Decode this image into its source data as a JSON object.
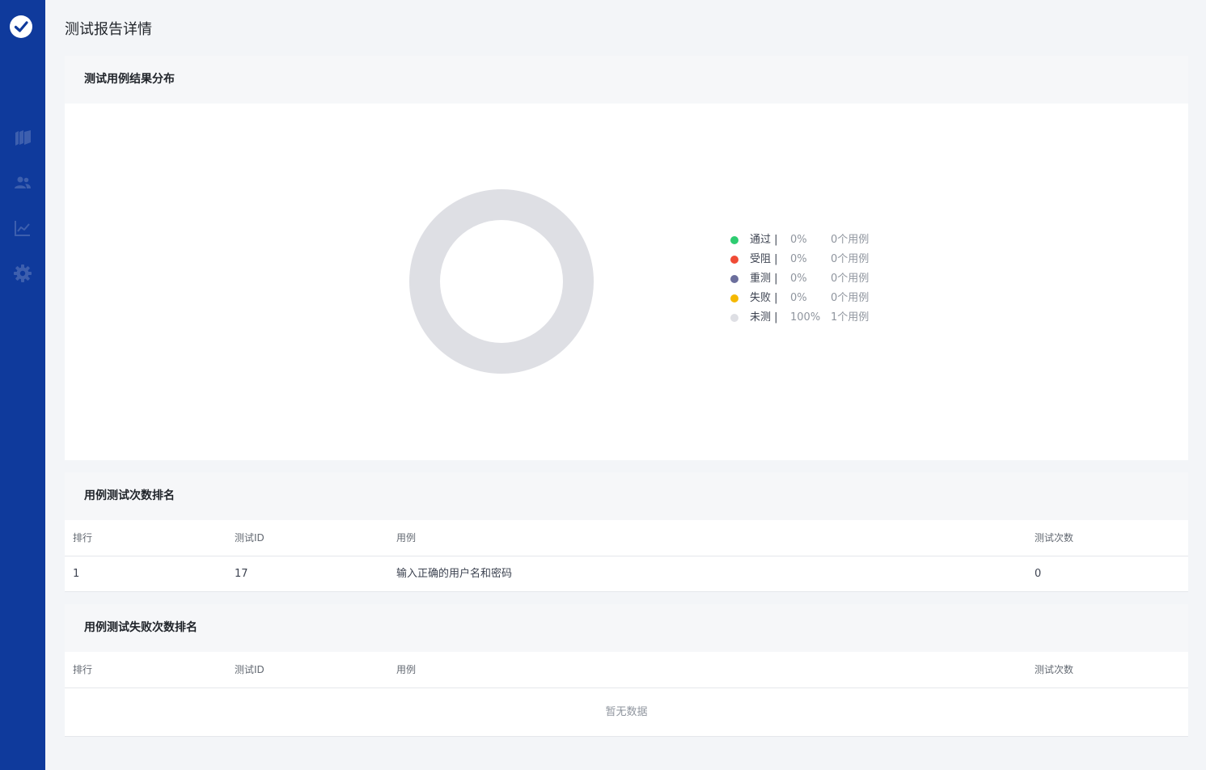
{
  "page": {
    "title": "测试报告详情"
  },
  "sidebar": {
    "logo_icon": "check-circle-logo",
    "items": [
      {
        "icon": "layers-icon"
      },
      {
        "icon": "users-icon"
      },
      {
        "icon": "trend-chart-icon"
      },
      {
        "icon": "gear-icon"
      }
    ],
    "color": "#0f3a9c"
  },
  "result_distribution": {
    "title": "测试用例结果分布",
    "legend": [
      {
        "name": "通过",
        "sep": "|",
        "percent": "0%",
        "count": "0个用例",
        "color": "#2ecc71"
      },
      {
        "name": "受阻",
        "sep": "|",
        "percent": "0%",
        "count": "0个用例",
        "color": "#f04b36"
      },
      {
        "name": "重测",
        "sep": "|",
        "percent": "0%",
        "count": "0个用例",
        "color": "#6b6e9c"
      },
      {
        "name": "失败",
        "sep": "|",
        "percent": "0%",
        "count": "0个用例",
        "color": "#f5b800"
      },
      {
        "name": "未测",
        "sep": "|",
        "percent": "100%",
        "count": "1个用例",
        "color": "#dedfe4"
      }
    ]
  },
  "chart_data": {
    "type": "pie",
    "categories": [
      "通过",
      "受阻",
      "重测",
      "失败",
      "未测"
    ],
    "values": [
      0,
      0,
      0,
      0,
      100
    ],
    "colors": [
      "#2ecc71",
      "#f04b36",
      "#6b6e9c",
      "#f5b800",
      "#dedfe4"
    ],
    "legend": "right"
  },
  "run_rank": {
    "title": "用例测试次数排名",
    "columns": [
      "排行",
      "测试ID",
      "用例",
      "测试次数"
    ],
    "rows": [
      [
        "1",
        "17",
        "输入正确的用户名和密码",
        "0"
      ]
    ]
  },
  "fail_rank": {
    "title": "用例测试失败次数排名",
    "columns": [
      "排行",
      "测试ID",
      "用例",
      "测试次数"
    ],
    "rows": [],
    "empty_text": "暂无数据"
  }
}
